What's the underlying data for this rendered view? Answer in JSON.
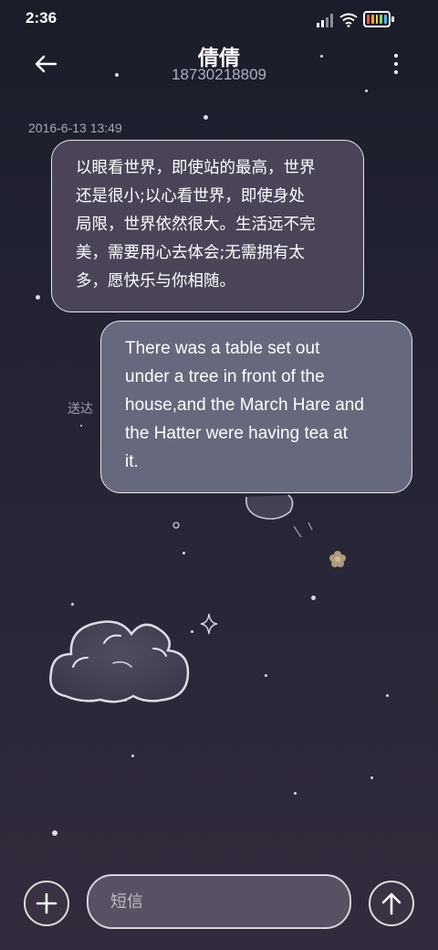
{
  "status_bar": {
    "time": "2:36",
    "battery_colors": [
      "#f05a3c",
      "#f7a23c",
      "#f7d84a",
      "#8cd46a",
      "#5ab0f0"
    ]
  },
  "header": {
    "contact_name": "倩倩",
    "phone_number": "18730218809",
    "icons": {
      "back": "arrow-left-icon",
      "more": "more-vertical-icon"
    }
  },
  "conversation": {
    "timestamp": "2016-6-13 13:49",
    "incoming": {
      "lines": [
        "以眼看世界，即使站的最高，世界",
        "还是很小;以心看世界，即使身处",
        "局限，世界依然很大。生活远不完",
        "美，需要用心去体会;无需拥有太",
        "多，愿快乐与你相随。"
      ]
    },
    "outgoing": {
      "lines": [
        "There was a table set out",
        "under a tree in front of the",
        "house,and the March Hare and",
        "the Hatter were having tea at",
        "it."
      ],
      "status": "送达"
    }
  },
  "composer": {
    "placeholder": "短信",
    "value": "",
    "icons": {
      "add": "plus-icon",
      "send": "arrow-up-icon"
    }
  }
}
